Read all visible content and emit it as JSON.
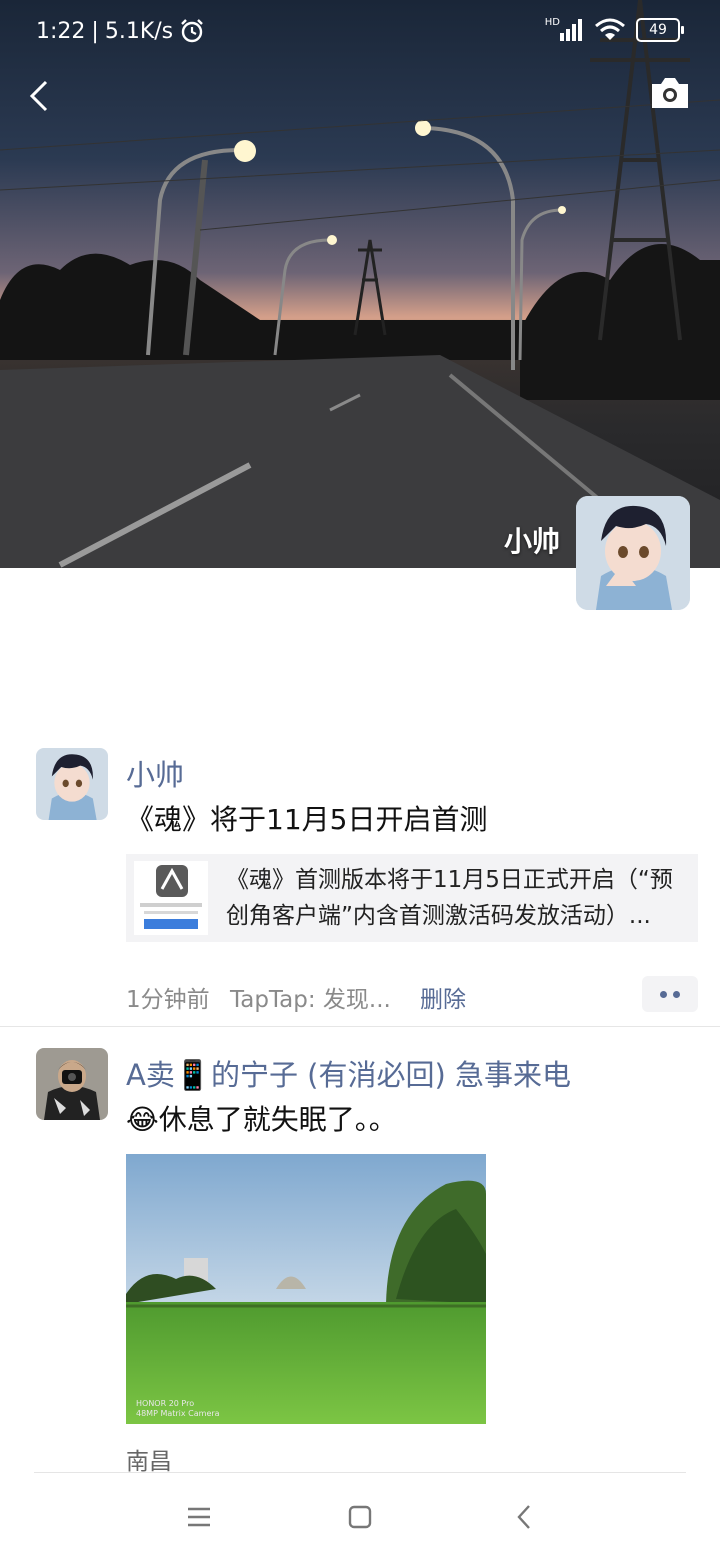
{
  "status_bar": {
    "time": "1:22",
    "speed": "5.1K/s",
    "signal_label": "HD",
    "battery": "49"
  },
  "cover": {
    "owner_name": "小帅"
  },
  "posts": [
    {
      "author": "小帅",
      "text": "《魂》将于11月5日开启首测",
      "link": {
        "line1": "《魂》首测版本将于11月5日正式开启（“预",
        "line2": "创角客户端”内含首测激活码发放活动）..."
      },
      "time": "1分钟前",
      "source": "TapTap: 发现...",
      "delete_label": "删除"
    },
    {
      "author": "A卖📱的宁子 (有消必回) 急事来电",
      "text": "😂休息了就失眠了。。",
      "location": "南昌"
    }
  ],
  "icons": [
    "back-icon",
    "camera-icon",
    "alarm-icon",
    "wifi-icon",
    "menu-icon",
    "home-icon",
    "nav-back-icon"
  ],
  "colors": {
    "link_blue": "#576b95",
    "meta_gray": "#8a8a8a",
    "card_bg": "#f3f3f5"
  }
}
